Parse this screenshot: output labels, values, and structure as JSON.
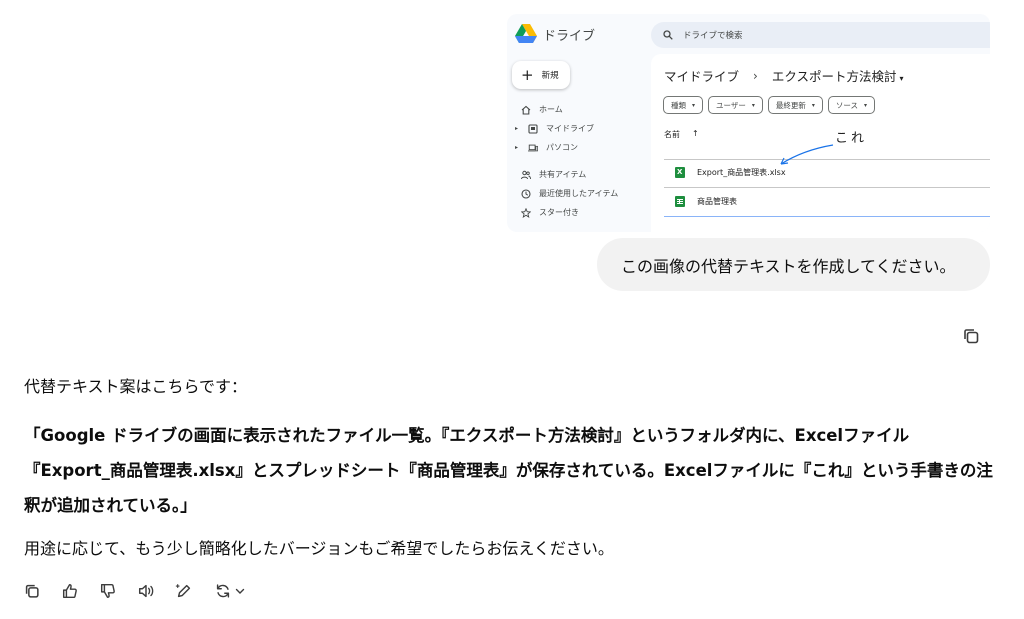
{
  "drive": {
    "logo_text": "ドライブ",
    "search_placeholder": "ドライブで検索",
    "new_label": "新規",
    "nav": [
      {
        "label": "ホーム"
      },
      {
        "label": "マイドライブ"
      },
      {
        "label": "パソコン"
      },
      {
        "label": "共有アイテム"
      },
      {
        "label": "最近使用したアイテム"
      },
      {
        "label": "スター付き"
      }
    ],
    "breadcrumb": {
      "root": "マイドライブ",
      "separator": "›",
      "folder": "エクスポート方法検討"
    },
    "filters": [
      "種類",
      "ユーザー",
      "最終更新",
      "ソース"
    ],
    "column_name": "名前",
    "sort_arrow": "↑",
    "annotation": "これ",
    "files": [
      {
        "name": "Export_商品管理表.xlsx",
        "type": "excel"
      },
      {
        "name": "商品管理表",
        "type": "sheets"
      }
    ],
    "colors": {
      "excel": "#1e8e3e",
      "sheets": "#1e8e3e",
      "annotation_arrow": "#1a73e8"
    }
  },
  "user_message": "この画像の代替テキストを作成してください。",
  "assistant": {
    "intro": "代替テキスト案はこちらです：",
    "quote": "「Google ドライブの画面に表示されたファイル一覧。『エクスポート方法検討』というフォルダ内に、Excelファイル『Export_商品管理表.xlsx』とスプレッドシート『商品管理表』が保存されている。Excelファイルに『これ』という手書きの注釈が追加されている。」",
    "outro": "用途に応じて、もう少し簡略化したバージョンもご希望でしたらお伝えください。"
  }
}
